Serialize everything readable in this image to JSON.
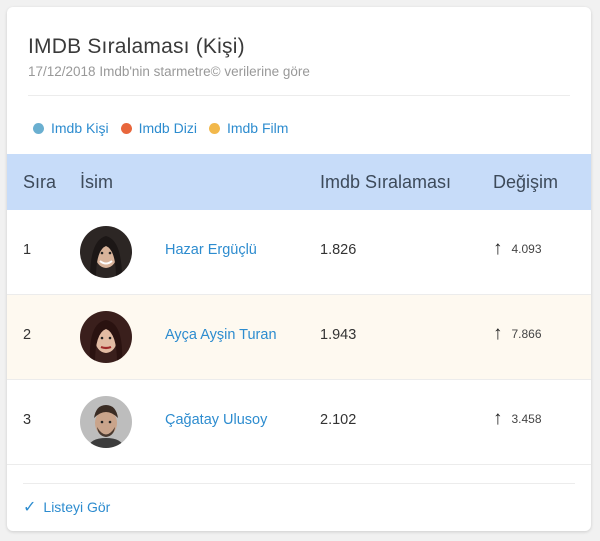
{
  "header": {
    "title": "IMDB Sıralaması (Kişi)",
    "subtitle": "17/12/2018 Imdb'nin starmetre© verilerine göre"
  },
  "tabs": [
    {
      "label": "Imdb Kişi",
      "color": "#6aafd0"
    },
    {
      "label": "Imdb Dizi",
      "color": "#e8663c"
    },
    {
      "label": "Imdb Film",
      "color": "#f2b84b"
    }
  ],
  "table": {
    "columns": [
      "Sıra",
      "İsim",
      "Imdb Sıralaması",
      "Değişim"
    ],
    "rows": [
      {
        "rank": "1",
        "name": "Hazar Ergüçlü",
        "score": "1.826",
        "change": "4.093",
        "change_icon": "arrow-up-icon"
      },
      {
        "rank": "2",
        "name": "Ayça Ayşin Turan",
        "score": "1.943",
        "change": "7.866",
        "change_icon": "arrow-up-icon"
      },
      {
        "rank": "3",
        "name": "Çağatay Ulusoy",
        "score": "2.102",
        "change": "3.458",
        "change_icon": "arrow-up-icon"
      }
    ]
  },
  "footer": {
    "link_label": "Listeyi Gör",
    "link_icon": "check-icon"
  },
  "colors": {
    "header_bg": "#c7dcf9",
    "link": "#2d8ccf",
    "alt_row": "#fef9f0"
  }
}
